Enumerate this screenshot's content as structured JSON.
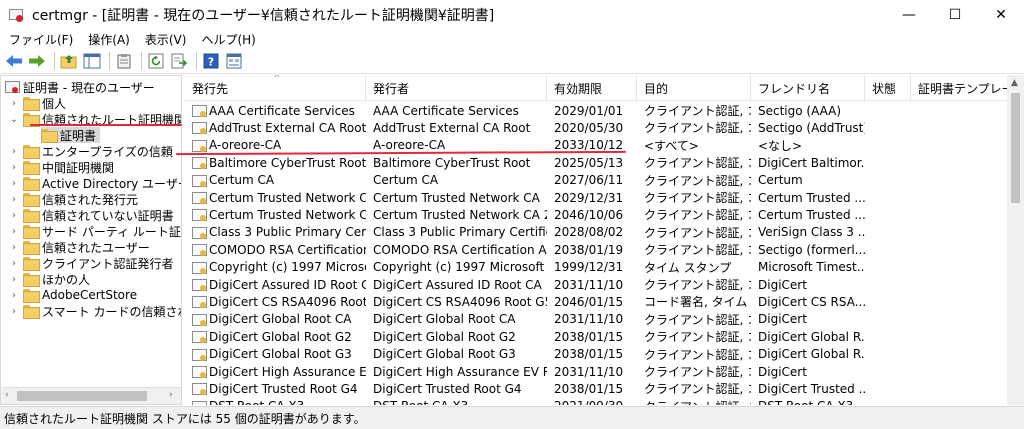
{
  "window": {
    "title": "certmgr - [証明書 - 現在のユーザー¥信頼されたルート証明機関¥証明書]",
    "controls": {
      "minimize": "—",
      "maximize": "☐",
      "close": "✕"
    }
  },
  "menu": [
    {
      "label": "ファイル(F)"
    },
    {
      "label": "操作(A)"
    },
    {
      "label": "表示(V)"
    },
    {
      "label": "ヘルプ(H)"
    }
  ],
  "toolbar": {
    "icons": [
      "back-arrow-icon",
      "forward-arrow-icon",
      "up-folder-icon",
      "show-hide-tree-icon",
      "clipboard-icon",
      "refresh-icon",
      "export-list-icon",
      "help-icon",
      "properties-icon"
    ]
  },
  "tree": {
    "items": [
      {
        "label": "証明書 - 現在のユーザー",
        "expander": "",
        "icon": "root-cert-icon"
      },
      {
        "label": "個人",
        "expander": "›"
      },
      {
        "label": "信頼されたルート証明機関",
        "expander": "⌄"
      },
      {
        "label": "証明書",
        "expander": ""
      },
      {
        "label": "エンタープライズの信頼",
        "expander": "›"
      },
      {
        "label": "中間証明機関",
        "expander": "›"
      },
      {
        "label": "Active Directory ユーザー オ",
        "expander": "›"
      },
      {
        "label": "信頼された発行元",
        "expander": "›"
      },
      {
        "label": "信頼されていない証明書",
        "expander": "›"
      },
      {
        "label": "サード パーティ ルート証明機関",
        "expander": "›"
      },
      {
        "label": "信頼されたユーザー",
        "expander": "›"
      },
      {
        "label": "クライアント認証発行者",
        "expander": "›"
      },
      {
        "label": "ほかの人",
        "expander": "›"
      },
      {
        "label": "AdobeCertStore",
        "expander": "›"
      },
      {
        "label": "スマート カードの信頼されたルート",
        "expander": "›"
      }
    ],
    "scroll_left": "‹",
    "scroll_right": "›"
  },
  "list": {
    "sort_indicator": "^",
    "columns": [
      "発行先",
      "発行者",
      "有効期限",
      "目的",
      "フレンドリ名",
      "状態",
      "証明書テンプレー"
    ],
    "rows": [
      {
        "to": "AAA Certificate Services",
        "by": "AAA Certificate Services",
        "exp": "2029/01/01",
        "purpose": "クライアント認証, コー...",
        "friendly": "Sectigo (AAA)"
      },
      {
        "to": "AddTrust External CA Root",
        "by": "AddTrust External CA Root",
        "exp": "2020/05/30",
        "purpose": "クライアント認証, コー...",
        "friendly": "Sectigo (AddTrust)"
      },
      {
        "to": "A-oreore-CA",
        "by": "A-oreore-CA",
        "exp": "2033/10/12",
        "purpose": "<すべて>",
        "friendly": "<なし>"
      },
      {
        "to": "Baltimore CyberTrust Root",
        "by": "Baltimore CyberTrust Root",
        "exp": "2025/05/13",
        "purpose": "クライアント認証, コー...",
        "friendly": "DigiCert Baltimor..."
      },
      {
        "to": "Certum CA",
        "by": "Certum CA",
        "exp": "2027/06/11",
        "purpose": "クライアント認証, コー...",
        "friendly": "Certum"
      },
      {
        "to": "Certum Trusted Network CA",
        "by": "Certum Trusted Network CA",
        "exp": "2029/12/31",
        "purpose": "クライアント認証, コー...",
        "friendly": "Certum Trusted ..."
      },
      {
        "to": "Certum Trusted Network C...",
        "by": "Certum Trusted Network CA 2",
        "exp": "2046/10/06",
        "purpose": "クライアント認証, コー...",
        "friendly": "Certum Trusted ..."
      },
      {
        "to": "Class 3 Public Primary Certif...",
        "by": "Class 3 Public Primary Certific...",
        "exp": "2028/08/02",
        "purpose": "クライアント認証, コー...",
        "friendly": "VeriSign Class 3 ..."
      },
      {
        "to": "COMODO RSA Certification ...",
        "by": "COMODO RSA Certification Au...",
        "exp": "2038/01/19",
        "purpose": "クライアント認証, コー...",
        "friendly": "Sectigo (formerl..."
      },
      {
        "to": "Copyright (c) 1997 Microsof...",
        "by": "Copyright (c) 1997 Microsoft ...",
        "exp": "1999/12/31",
        "purpose": "タイム スタンプ",
        "friendly": "Microsoft Timest..."
      },
      {
        "to": "DigiCert Assured ID Root CA",
        "by": "DigiCert Assured ID Root CA",
        "exp": "2031/11/10",
        "purpose": "クライアント認証, コー...",
        "friendly": "DigiCert"
      },
      {
        "to": "DigiCert CS RSA4096 Root G5",
        "by": "DigiCert CS RSA4096 Root G5",
        "exp": "2046/01/15",
        "purpose": "コード署名, タイム ス...",
        "friendly": "DigiCert CS RSA..."
      },
      {
        "to": "DigiCert Global Root CA",
        "by": "DigiCert Global Root CA",
        "exp": "2031/11/10",
        "purpose": "クライアント認証, コー...",
        "friendly": "DigiCert"
      },
      {
        "to": "DigiCert Global Root G2",
        "by": "DigiCert Global Root G2",
        "exp": "2038/01/15",
        "purpose": "クライアント認証, コー...",
        "friendly": "DigiCert Global R..."
      },
      {
        "to": "DigiCert Global Root G3",
        "by": "DigiCert Global Root G3",
        "exp": "2038/01/15",
        "purpose": "クライアント認証, コー...",
        "friendly": "DigiCert Global R..."
      },
      {
        "to": "DigiCert High Assurance EV ...",
        "by": "DigiCert High Assurance EV R...",
        "exp": "2031/11/10",
        "purpose": "クライアント認証, コー...",
        "friendly": "DigiCert"
      },
      {
        "to": "DigiCert Trusted Root G4",
        "by": "DigiCert Trusted Root G4",
        "exp": "2038/01/15",
        "purpose": "クライアント認証, コー...",
        "friendly": "DigiCert Trusted ..."
      },
      {
        "to": "DST Root CA X3",
        "by": "DST Root CA X3",
        "exp": "2021/09/30",
        "purpose": "クライアント認証, ドキ...",
        "friendly": "DST Root CA X3"
      }
    ]
  },
  "status": "信頼されたルート証明機関 ストアには 55 個の証明書があります。",
  "colors": {
    "annotation": "#e2293b",
    "selection": "#d9d9d9",
    "folder": "#f5cf66",
    "back": "#3a7fd5",
    "forward": "#5aa02c"
  }
}
